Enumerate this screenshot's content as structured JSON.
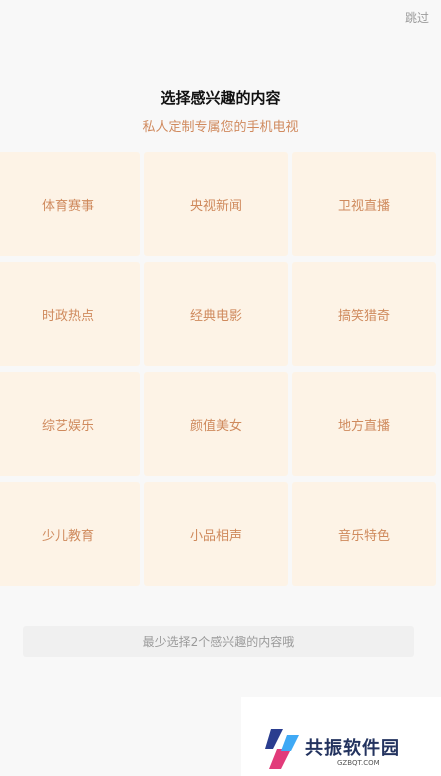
{
  "header": {
    "skip_label": "跳过"
  },
  "intro": {
    "title": "选择感兴趣的内容",
    "subtitle": "私人定制专属您的手机电视"
  },
  "categories": [
    {
      "label": "体育赛事"
    },
    {
      "label": "央视新闻"
    },
    {
      "label": "卫视直播"
    },
    {
      "label": "时政热点"
    },
    {
      "label": "经典电影"
    },
    {
      "label": "搞笑猎奇"
    },
    {
      "label": "综艺娱乐"
    },
    {
      "label": "颜值美女"
    },
    {
      "label": "地方直播"
    },
    {
      "label": "少儿教育"
    },
    {
      "label": "小品相声"
    },
    {
      "label": "音乐特色"
    }
  ],
  "footer": {
    "confirm_label": "最少选择2个感兴趣的内容哦"
  },
  "watermark": {
    "name": "共振软件园",
    "url": "GZBQT.COM"
  },
  "colors": {
    "accent": "#cf8a5d",
    "tile_background": "#fdf3e6",
    "page_background": "#f8f8f8",
    "button_background": "#f0f0f0"
  }
}
